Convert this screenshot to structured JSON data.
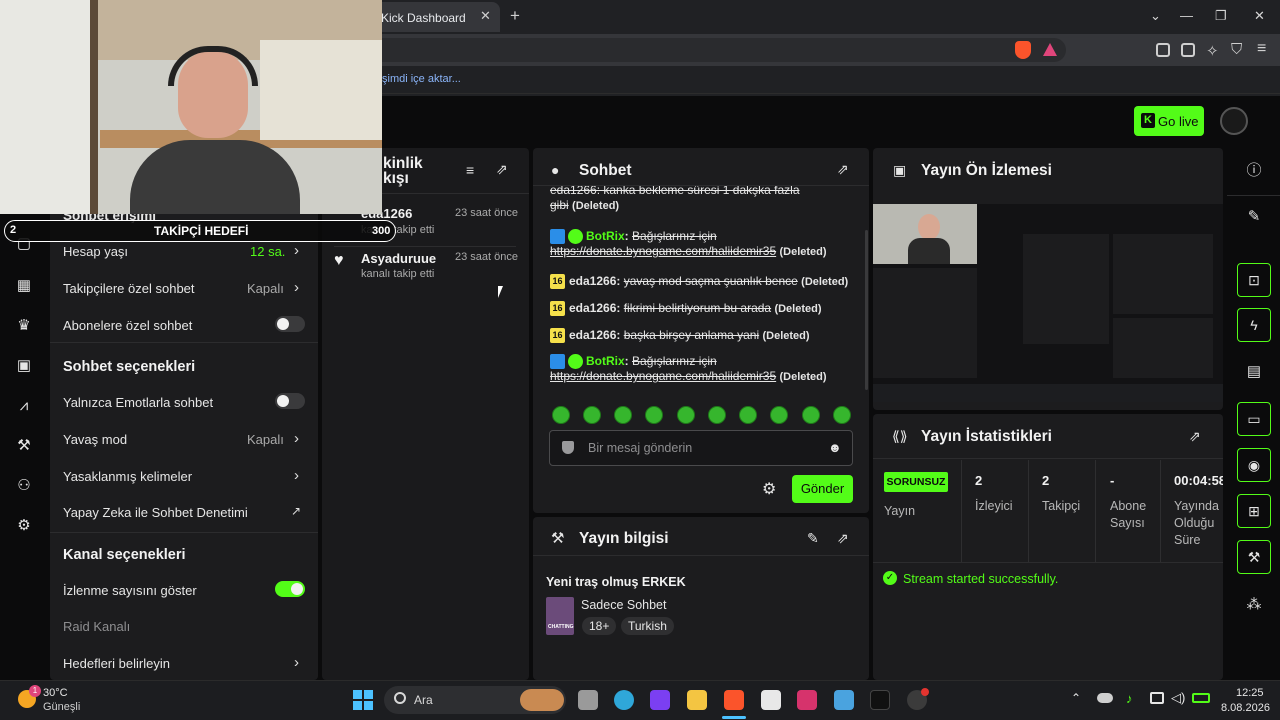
{
  "browser": {
    "tab_title": "Kick Dashboard",
    "tab_close": "✕",
    "new_tab": "+",
    "url_fragment": "n",
    "bookmark_text": "şimdi içe aktar...",
    "window_controls": {
      "minimize": "—",
      "restore": "❐",
      "close": "✕",
      "dropdown": "⌄"
    }
  },
  "header": {
    "go_live_label": "Go live",
    "kick_logo_letter": "K"
  },
  "webcam": {
    "goal_label": "TAKİPÇİ HEDEFİ",
    "goal_current": "2",
    "goal_target": "300",
    "settings_partial_title": "Sohbet erişimi"
  },
  "settings": {
    "rows": [
      {
        "label": "Hesap yaşı",
        "value": "12 sa.",
        "type": "link"
      },
      {
        "label": "Takipçilere özel sohbet",
        "value": "Kapalı",
        "type": "link"
      },
      {
        "label": "Abonelere özel sohbet",
        "value": "",
        "type": "toggle",
        "on": false
      }
    ],
    "chat_options_title": "Sohbet seçenekleri",
    "chat_options": [
      {
        "label": "Yalnızca Emotlarla sohbet",
        "value": "",
        "type": "toggle",
        "on": false
      },
      {
        "label": "Yavaş mod",
        "value": "Kapalı",
        "type": "link"
      },
      {
        "label": "Yasaklanmış kelimeler",
        "value": "",
        "type": "link"
      },
      {
        "label": "Yapay Zeka ile Sohbet Denetimi",
        "value": "",
        "type": "external"
      }
    ],
    "channel_options_title": "Kanal seçenekleri",
    "channel_options": [
      {
        "label": "İzlenme sayısını göster",
        "type": "toggle",
        "on": true
      },
      {
        "label": "Raid Kanalı",
        "type": "disabled"
      },
      {
        "label": "Hedefleri belirleyin",
        "type": "link"
      }
    ]
  },
  "activity": {
    "title_line1": "kinlik",
    "title_line2": "kışı",
    "items": [
      {
        "name": "eda1266",
        "action": "kanalı takip etti",
        "time": "23 saat önce"
      },
      {
        "name": "Asyaduruue",
        "action": "kanalı takip etti",
        "time": "23 saat önce"
      }
    ]
  },
  "chat": {
    "title": "Sohbet",
    "messages": [
      {
        "partial_top": "eda1266: kanka bekleme süresi 1 dakşka fazla",
        "text": "gibi",
        "deleted": "(Deleted)"
      },
      {
        "badge": "bot",
        "user": "BotRix",
        "text": "Bağışlarınız için",
        "link": "https://donate.bynogame.com/haliidemir35",
        "deleted": "(Deleted)"
      },
      {
        "badge": "16",
        "user": "eda1266",
        "text": "yavaş mod saçma şuanlık bence",
        "deleted": "(Deleted)"
      },
      {
        "badge": "16",
        "user": "eda1266",
        "text": "fikrimi belirtiyorum bu arada",
        "deleted": "(Deleted)"
      },
      {
        "badge": "16",
        "user": "eda1266",
        "text": "başka birşey anlama yani",
        "deleted": "(Deleted)"
      },
      {
        "badge": "bot",
        "user": "BotRix",
        "text": "Bağışlarınız için",
        "link": "https://donate.bynogame.com/haliidemir35",
        "deleted": "(Deleted)"
      }
    ],
    "input_placeholder": "Bir mesaj gönderin",
    "send_label": "Gönder",
    "emote_count": 10
  },
  "stream_info": {
    "title": "Yayın bilgisi",
    "stream_title": "Yeni traş olmuş ERKEK",
    "category": "Sadece Sohbet",
    "category_thumb_text": "CHATTING",
    "tags": [
      "18+",
      "Turkish"
    ]
  },
  "preview": {
    "title": "Yayın Ön İzlemesi"
  },
  "stats": {
    "title": "Yayın İstatistikleri",
    "status_badge": "SORUNSUZ",
    "columns": [
      {
        "value": "",
        "label": "Yayın"
      },
      {
        "value": "2",
        "label": "İzleyici"
      },
      {
        "value": "2",
        "label": "Takipçi"
      },
      {
        "value": "-",
        "label": "Abone Sayısı"
      },
      {
        "value": "00:04:58",
        "label": "Yayında Olduğu Süre"
      }
    ],
    "success_message": "Stream started successfully."
  },
  "taskbar": {
    "weather_temp": "30°C",
    "weather_desc": "Güneşli",
    "weather_badge": "1",
    "search_label": "Ara",
    "time": "12:25",
    "date": "8.08.2026"
  },
  "colors": {
    "accent": "#53fc18",
    "panel": "#1c1c1e",
    "background": "#0b0b0c"
  }
}
